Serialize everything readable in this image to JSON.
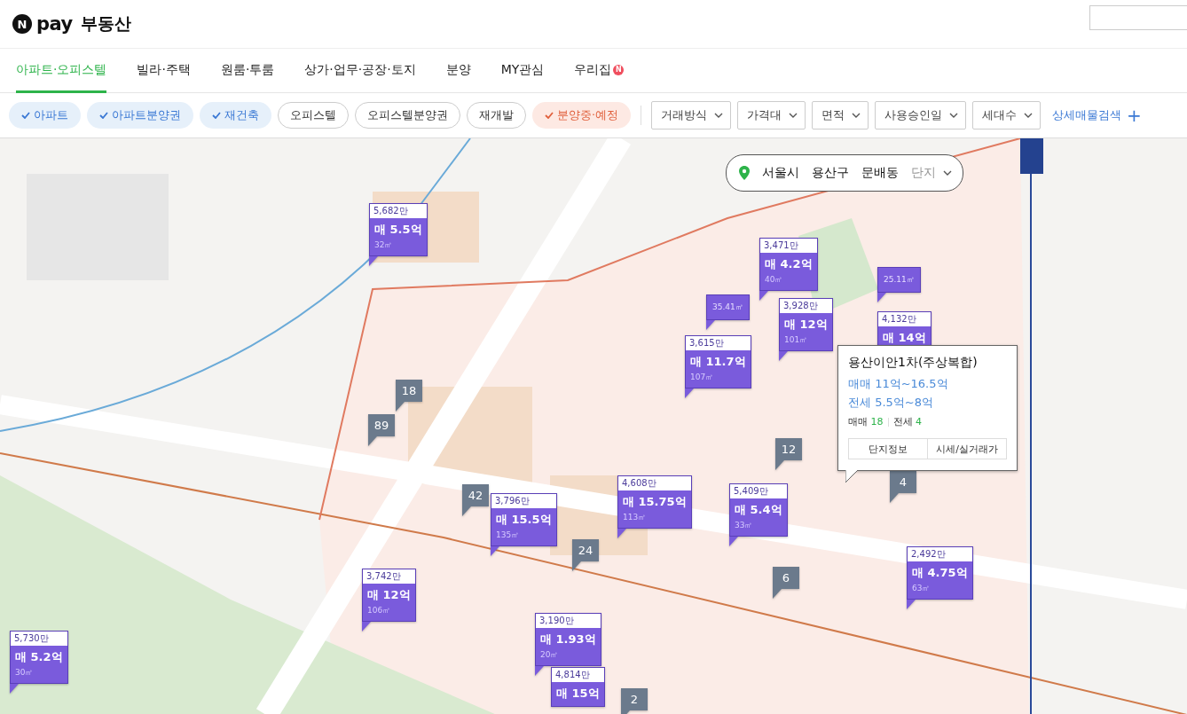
{
  "header": {
    "logo_badge": "N",
    "logo_text": "pay",
    "title": "부동산"
  },
  "tabs": [
    {
      "label": "아파트·오피스텔",
      "selected": true
    },
    {
      "label": "빌라·주택",
      "selected": false
    },
    {
      "label": "원룸·투룸",
      "selected": false
    },
    {
      "label": "상가·업무·공장·토지",
      "selected": false
    },
    {
      "label": "분양",
      "selected": false
    },
    {
      "label": "MY관심",
      "selected": false
    },
    {
      "label": "우리집",
      "selected": false,
      "badge": "N"
    }
  ],
  "chips": [
    {
      "label": "아파트",
      "kind": "type",
      "selected": true
    },
    {
      "label": "아파트분양권",
      "kind": "type",
      "selected": true
    },
    {
      "label": "재건축",
      "kind": "type",
      "selected": true
    },
    {
      "label": "오피스텔",
      "kind": "type",
      "selected": false
    },
    {
      "label": "오피스텔분양권",
      "kind": "type",
      "selected": false
    },
    {
      "label": "재개발",
      "kind": "type",
      "selected": false
    },
    {
      "label": "분양중·예정",
      "kind": "presale",
      "selected": true
    }
  ],
  "dropdowns": [
    "거래방식",
    "가격대",
    "면적",
    "사용승인일",
    "세대수"
  ],
  "detail_search": {
    "label": "상세매물검색",
    "icon": "+"
  },
  "breadcrumb": {
    "items": [
      "서울시",
      "용산구",
      "문배동"
    ],
    "placeholder": "단지"
  },
  "markers": [
    {
      "kind": "price",
      "unit_price": "5,682만",
      "price": "매 5.5억",
      "area": "32㎡"
    },
    {
      "kind": "area",
      "area": "35.41㎡"
    },
    {
      "kind": "price",
      "unit_price": "3,471만",
      "price": "매 4.2억",
      "area": "40㎡"
    },
    {
      "kind": "price",
      "unit_price": "3,928만",
      "price": "매 12억",
      "area": "101㎡"
    },
    {
      "kind": "area",
      "area": "25.11㎡"
    },
    {
      "kind": "price",
      "unit_price": "4,132만",
      "price": "매 14억"
    },
    {
      "kind": "price",
      "unit_price": "3,615만",
      "price": "매 11.7억",
      "area": "107㎡"
    },
    {
      "kind": "count",
      "count": "18"
    },
    {
      "kind": "count",
      "count": "89"
    },
    {
      "kind": "count",
      "count": "42"
    },
    {
      "kind": "price",
      "unit_price": "3,796만",
      "price": "매 15.5억",
      "area": "135㎡"
    },
    {
      "kind": "price",
      "unit_price": "4,608만",
      "price": "매 15.75억",
      "area": "113㎡"
    },
    {
      "kind": "count",
      "count": "24"
    },
    {
      "kind": "count",
      "count": "12"
    },
    {
      "kind": "price",
      "unit_price": "5,409만",
      "price": "매 5.4억",
      "area": "33㎡"
    },
    {
      "kind": "count",
      "count": "4"
    },
    {
      "kind": "count",
      "count": "6"
    },
    {
      "kind": "price",
      "unit_price": "2,492만",
      "price": "매 4.75억",
      "area": "63㎡"
    },
    {
      "kind": "price",
      "unit_price": "3,742만",
      "price": "매 12억",
      "area": "106㎡"
    },
    {
      "kind": "price",
      "unit_price": "3,190만",
      "price": "매 1.93억",
      "area": "20㎡"
    },
    {
      "kind": "price",
      "unit_price": "5,730만",
      "price": "매 5.2억",
      "area": "30㎡"
    },
    {
      "kind": "price",
      "unit_price": "4,814만",
      "price": "매 15억"
    },
    {
      "kind": "count",
      "count": "2"
    }
  ],
  "popup": {
    "title": "용산이안1차(주상복합)",
    "ranges": [
      "매매 11억~16.5억",
      "전세 5.5억~8억"
    ],
    "counts": [
      {
        "label": "매매",
        "value": "18"
      },
      {
        "label": "전세",
        "value": "4"
      }
    ],
    "buttons": [
      "단지정보",
      "시세/실거래가"
    ]
  }
}
